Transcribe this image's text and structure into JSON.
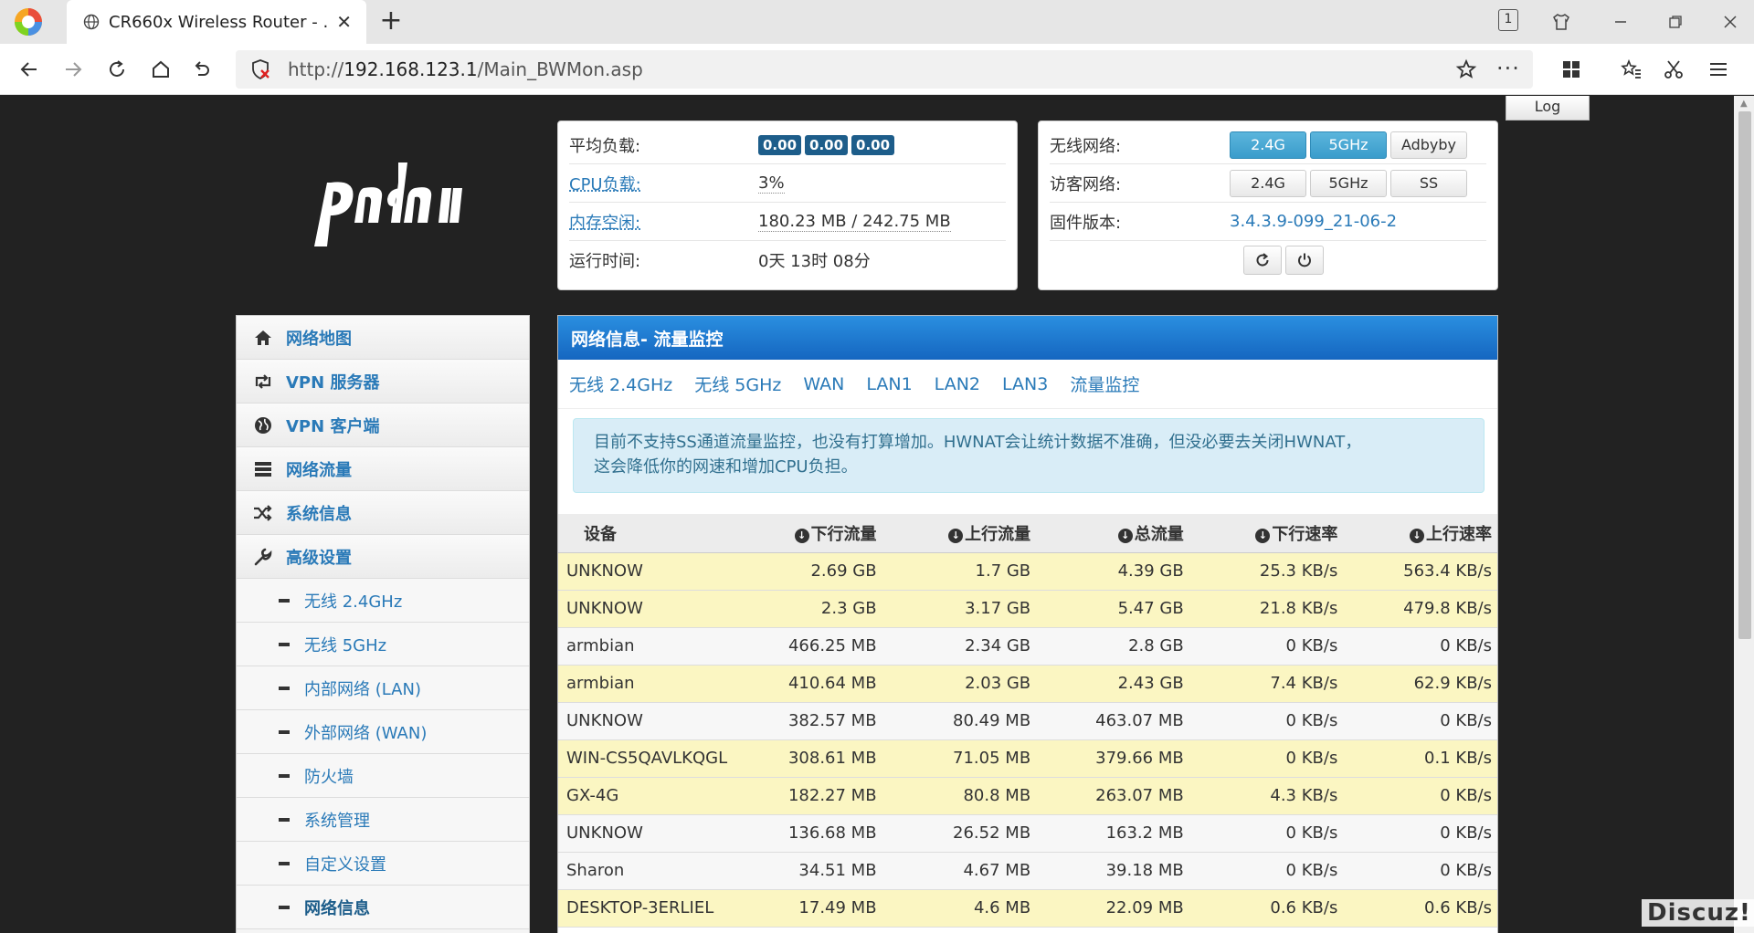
{
  "browser": {
    "tab_title": "CR660x Wireless Router - …",
    "tab_count": "1",
    "url_scheme": "http://",
    "url_host": "192.168.123.1",
    "url_path": "/Main_BWMon.asp"
  },
  "header": {
    "log_label": "Log",
    "logo_text": "padavan"
  },
  "status_left": {
    "avg_load_label": "平均负载:",
    "load": [
      "0.00",
      "0.00",
      "0.00"
    ],
    "cpu_label": "CPU负载:",
    "cpu_value": "3%",
    "mem_label": "内存空闲:",
    "mem_value": "180.23 MB / 242.75 MB",
    "uptime_label": "运行时间:",
    "uptime_value": "0天 13时 08分"
  },
  "status_right": {
    "wireless_label": "无线网络:",
    "wireless_buttons": [
      "2.4G",
      "5GHz",
      "Adbyby"
    ],
    "guest_label": "访客网络:",
    "guest_buttons": [
      "2.4G",
      "5GHz",
      "SS"
    ],
    "firmware_label": "固件版本:",
    "firmware_value": "3.4.3.9-099_21-06-2"
  },
  "sidebar": {
    "items": [
      {
        "label": "网络地图",
        "icon": "home-icon"
      },
      {
        "label": "VPN 服务器",
        "icon": "retweet-icon"
      },
      {
        "label": "VPN 客户端",
        "icon": "globe-icon"
      },
      {
        "label": "网络流量",
        "icon": "hdd-icon"
      },
      {
        "label": "系统信息",
        "icon": "random-icon"
      },
      {
        "label": "高级设置",
        "icon": "wrench-icon"
      }
    ],
    "subitems": [
      "无线 2.4GHz",
      "无线 5GHz",
      "内部网络 (LAN)",
      "外部网络 (WAN)",
      "防火墙",
      "系统管理",
      "自定义设置",
      "网络信息"
    ]
  },
  "main": {
    "title": "网络信息- 流量监控",
    "tabs": [
      "无线 2.4GHz",
      "无线 5GHz",
      "WAN",
      "LAN1",
      "LAN2",
      "LAN3",
      "流量监控"
    ],
    "alert_line1": "目前不支持SS通道流量监控，也没有打算增加。HWNAT会让统计数据不准确，但没必要去关闭HWNAT，",
    "alert_line2": "这会降低你的网速和增加CPU负担。",
    "columns": [
      "设备",
      "下行流量",
      "上行流量",
      "总流量",
      "下行速率",
      "上行速率"
    ],
    "rows": [
      [
        "UNKNOW",
        "2.69 GB",
        "1.7 GB",
        "4.39 GB",
        "25.3 KB/s",
        "563.4 KB/s"
      ],
      [
        "UNKNOW",
        "2.3 GB",
        "3.17 GB",
        "5.47 GB",
        "21.8 KB/s",
        "479.8 KB/s"
      ],
      [
        "armbian",
        "466.25 MB",
        "2.34 GB",
        "2.8 GB",
        "0 KB/s",
        "0 KB/s"
      ],
      [
        "armbian",
        "410.64 MB",
        "2.03 GB",
        "2.43 GB",
        "7.4 KB/s",
        "62.9 KB/s"
      ],
      [
        "UNKNOW",
        "382.57 MB",
        "80.49 MB",
        "463.07 MB",
        "0 KB/s",
        "0 KB/s"
      ],
      [
        "WIN-CS5QAVLKQGL",
        "308.61 MB",
        "71.05 MB",
        "379.66 MB",
        "0 KB/s",
        "0.1 KB/s"
      ],
      [
        "GX-4G",
        "182.27 MB",
        "80.8 MB",
        "263.07 MB",
        "4.3 KB/s",
        "0 KB/s"
      ],
      [
        "UNKNOW",
        "136.68 MB",
        "26.52 MB",
        "163.2 MB",
        "0 KB/s",
        "0 KB/s"
      ],
      [
        "Sharon",
        "34.51 MB",
        "4.67 MB",
        "39.18 MB",
        "0 KB/s",
        "0 KB/s"
      ],
      [
        "DESKTOP-3ERLIEL",
        "17.49 MB",
        "4.6 MB",
        "22.09 MB",
        "0.6 KB/s",
        "0.6 KB/s"
      ]
    ]
  },
  "watermark": "Discuz!",
  "colors": {
    "accent": "#2a7ab8",
    "highlight_row": "#fbf6c2",
    "header_blue": "#1566c0",
    "page_bg": "#222222"
  }
}
